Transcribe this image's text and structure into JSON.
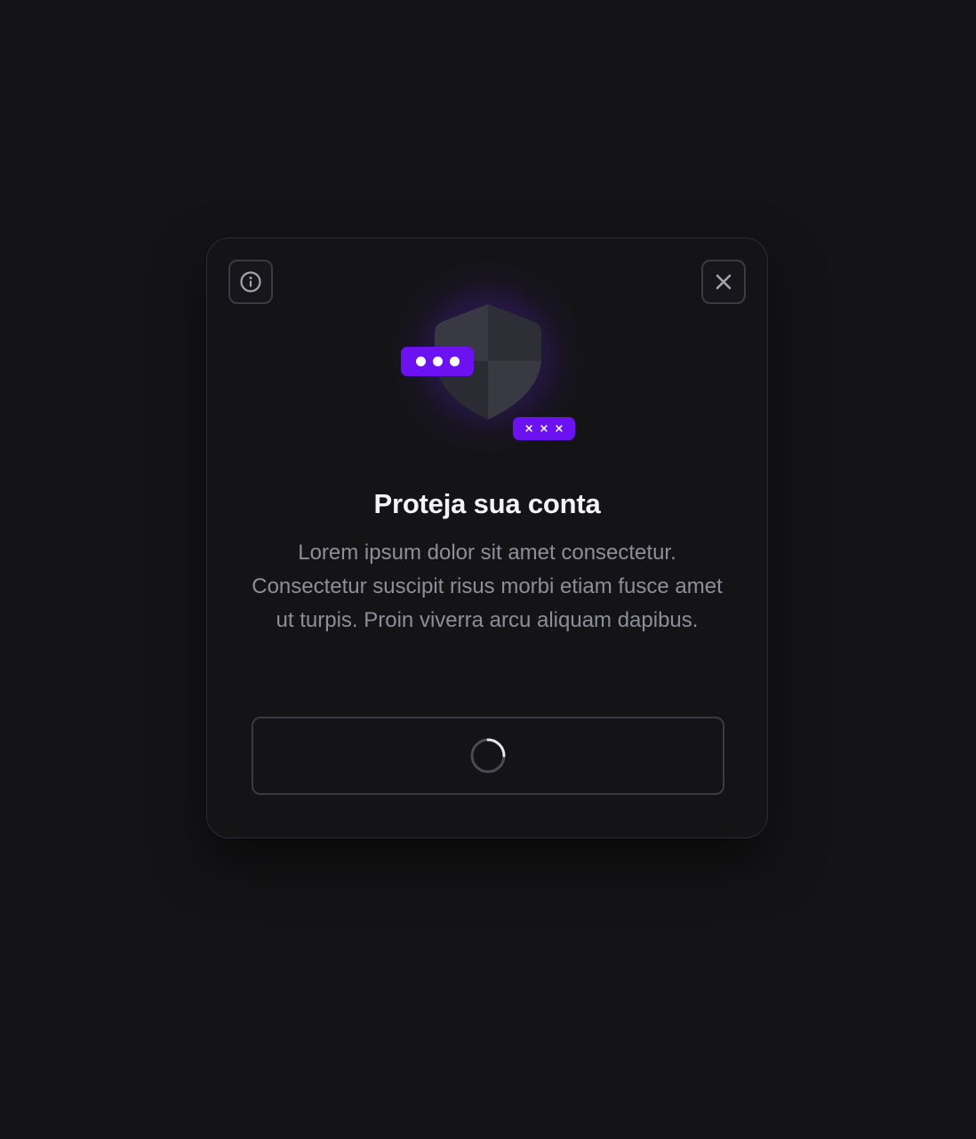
{
  "dialog": {
    "title": "Proteja sua conta",
    "description": "Lorem ipsum dolor sit amet consectetur. Consectetur suscipit risus morbi etiam fusce amet ut turpis. Proin viverra arcu aliquam dapibus.",
    "info_icon": "info-circle-icon",
    "close_icon": "close-x-icon",
    "illustration": {
      "icon": "shield-icon",
      "password_dots_icon": "password-dots-icon",
      "password_x_icon": "password-hidden-icon",
      "x_marks": [
        "×",
        "×",
        "×"
      ]
    },
    "action_button": {
      "state": "loading",
      "icon": "spinner-icon"
    }
  },
  "colors": {
    "background": "#141416",
    "card": "#141417",
    "border": "#2b2b33",
    "accent": "#6c12f2",
    "title": "#f4f4f6",
    "text_muted": "#8d8e9a"
  }
}
